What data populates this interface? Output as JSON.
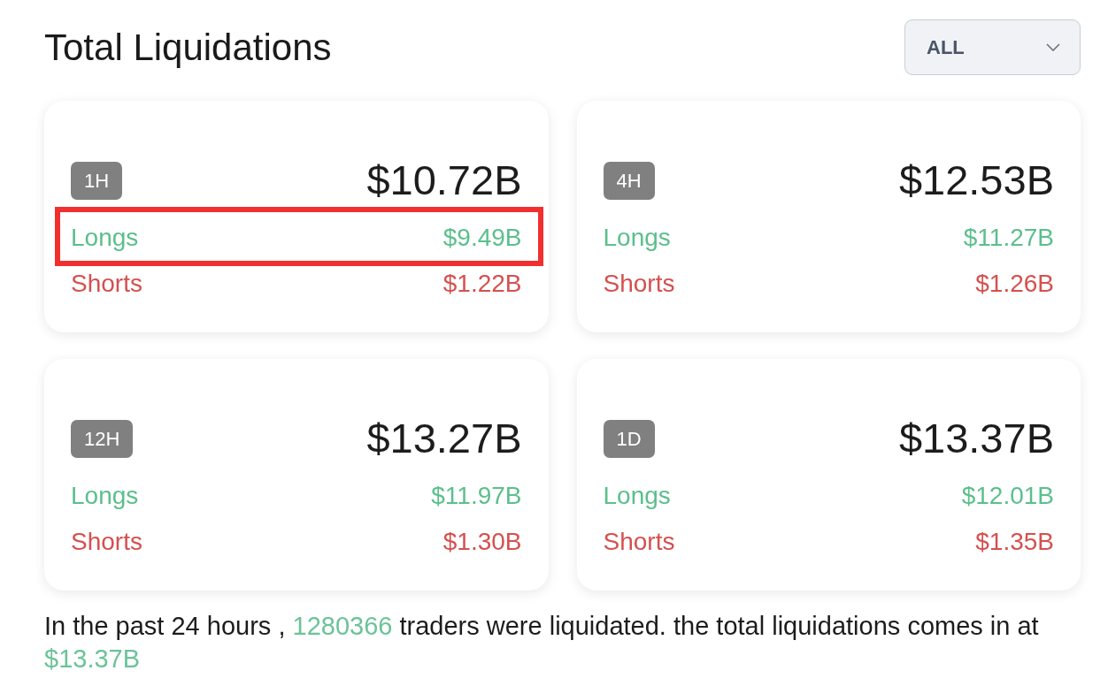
{
  "header": {
    "title": "Total Liquidations",
    "filter": {
      "value": "ALL"
    }
  },
  "cards": [
    {
      "period": "1H",
      "total": "$10.72B",
      "rows": [
        {
          "kind": "longs",
          "label": "Longs",
          "value": "$9.49B",
          "highlighted": true
        },
        {
          "kind": "shorts",
          "label": "Shorts",
          "value": "$1.22B",
          "highlighted": false
        }
      ]
    },
    {
      "period": "4H",
      "total": "$12.53B",
      "rows": [
        {
          "kind": "longs",
          "label": "Longs",
          "value": "$11.27B",
          "highlighted": false
        },
        {
          "kind": "shorts",
          "label": "Shorts",
          "value": "$1.26B",
          "highlighted": false
        }
      ]
    },
    {
      "period": "12H",
      "total": "$13.27B",
      "rows": [
        {
          "kind": "longs",
          "label": "Longs",
          "value": "$11.97B",
          "highlighted": false
        },
        {
          "kind": "shorts",
          "label": "Shorts",
          "value": "$1.30B",
          "highlighted": false
        }
      ]
    },
    {
      "period": "1D",
      "total": "$13.37B",
      "rows": [
        {
          "kind": "longs",
          "label": "Longs",
          "value": "$12.01B",
          "highlighted": false
        },
        {
          "kind": "shorts",
          "label": "Shorts",
          "value": "$1.35B",
          "highlighted": false
        }
      ]
    }
  ],
  "summary": {
    "parts": [
      {
        "kind": "plain",
        "text": "In the past 24 hours , "
      },
      {
        "kind": "figure",
        "text": "1280366"
      },
      {
        "kind": "plain",
        "text": " traders were liquidated. the total liquidations comes in at "
      },
      {
        "kind": "figure",
        "text": "$13.37B"
      }
    ]
  }
}
